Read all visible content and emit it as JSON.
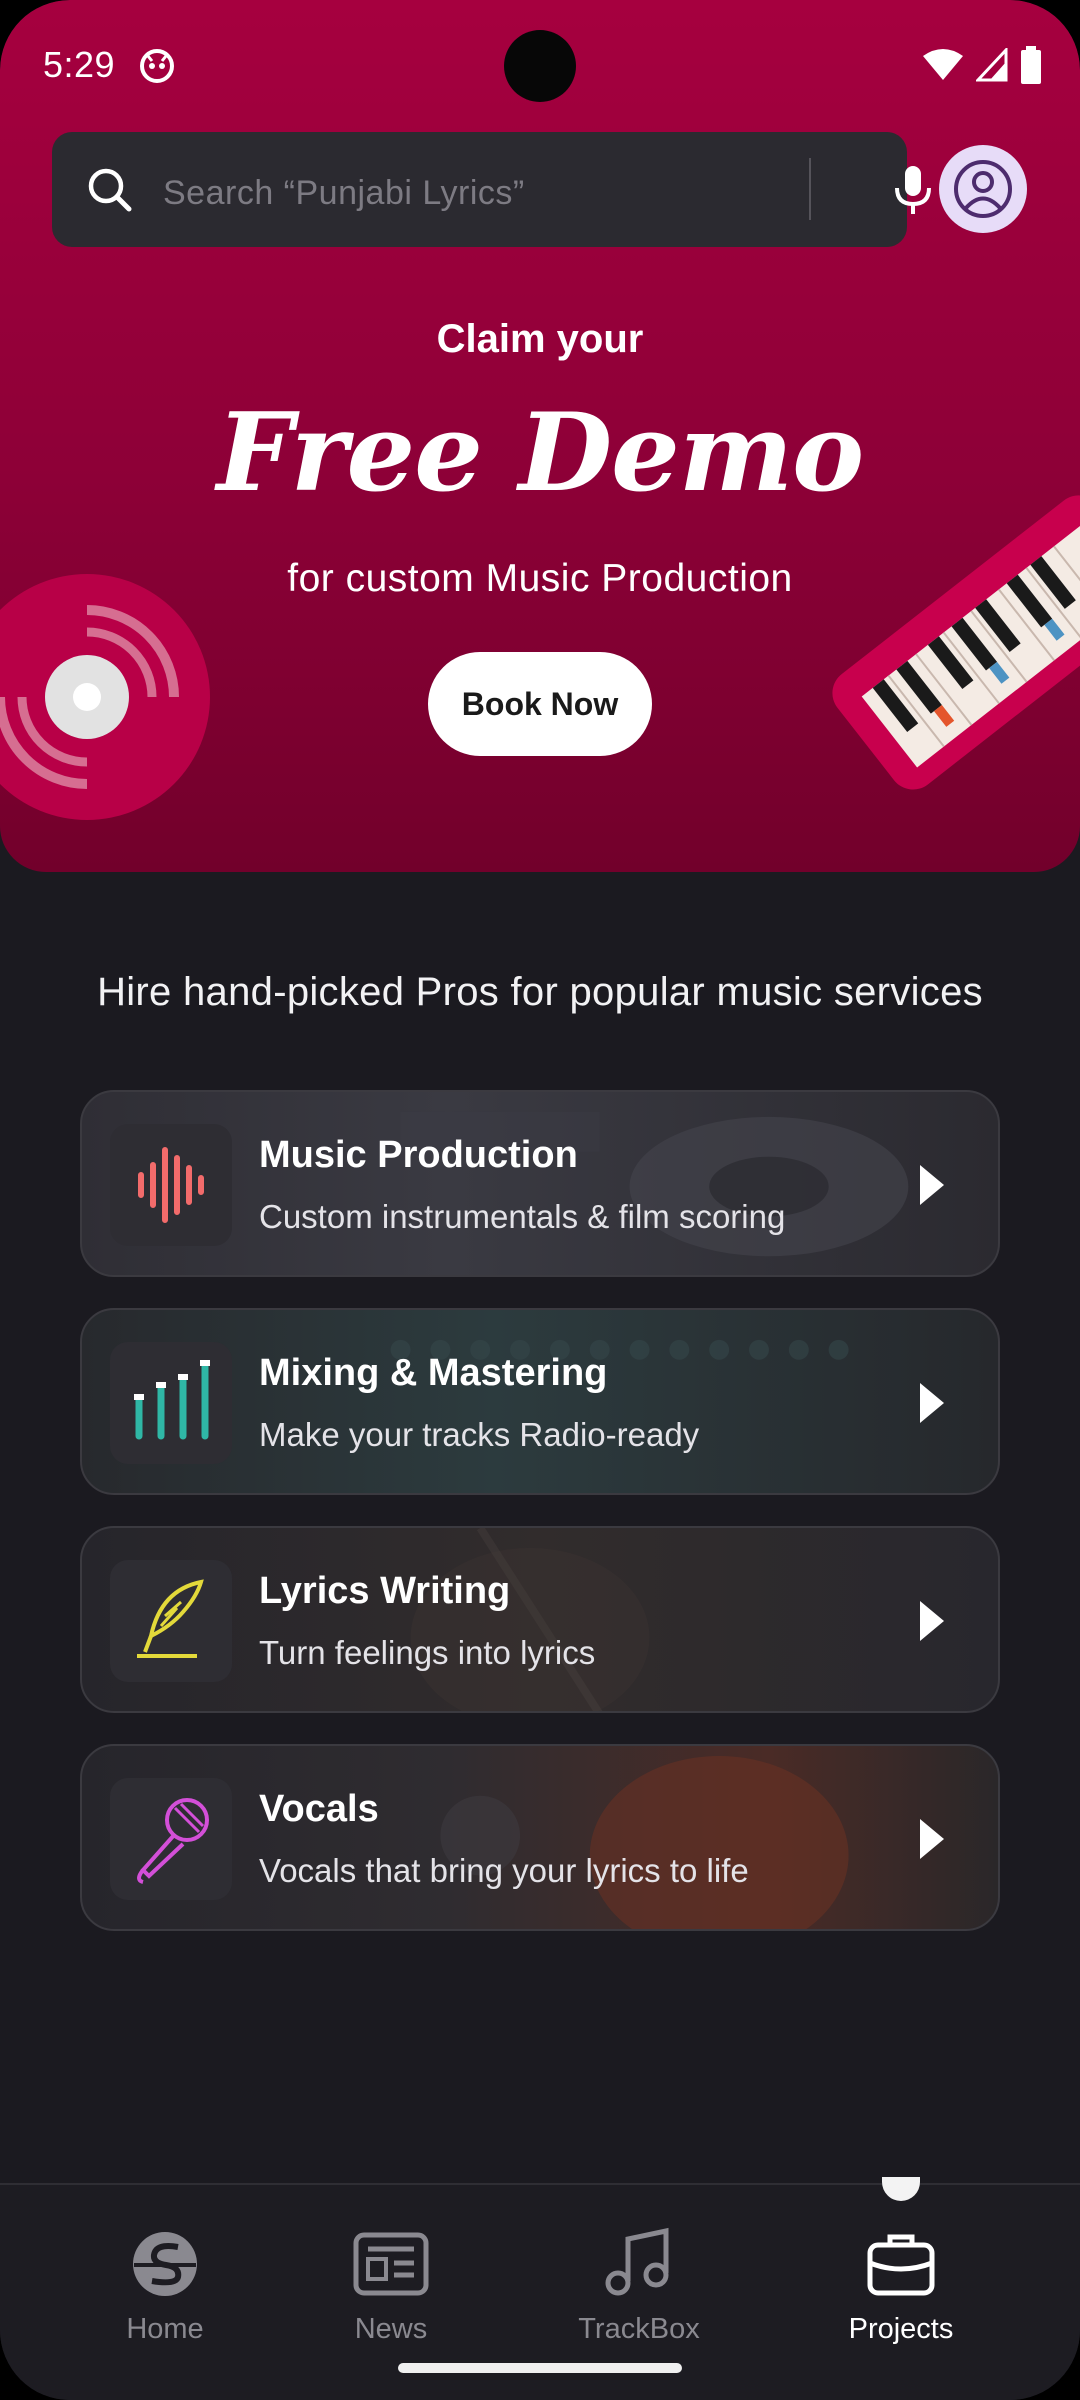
{
  "status_bar": {
    "time": "5:29"
  },
  "search": {
    "placeholder": "Search “Punjabi Lyrics”"
  },
  "hero": {
    "claim": "Claim your",
    "headline": "Free Demo",
    "subline": "for custom Music Production",
    "button_label": "Book Now",
    "background_color": "#a6003f"
  },
  "section_heading": "Hire hand-picked Pros for popular music services",
  "services": [
    {
      "title": "Music Production",
      "description": "Custom instrumentals & film scoring",
      "icon": "waveform-icon",
      "accent": "#f26b6b"
    },
    {
      "title": "Mixing & Mastering",
      "description": "Make your tracks Radio-ready",
      "icon": "faders-icon",
      "accent": "#2fb7a6"
    },
    {
      "title": "Lyrics Writing",
      "description": "Turn feelings into lyrics",
      "icon": "quill-icon",
      "accent": "#e3d93a"
    },
    {
      "title": "Vocals",
      "description": "Vocals that bring your lyrics to life",
      "icon": "microphone-icon",
      "accent": "#d34fd8"
    }
  ],
  "nav": {
    "items": [
      {
        "label": "Home",
        "icon": "home-logo-icon",
        "active": false
      },
      {
        "label": "News",
        "icon": "news-icon",
        "active": false
      },
      {
        "label": "TrackBox",
        "icon": "music-note-icon",
        "active": false
      },
      {
        "label": "Projects",
        "icon": "briefcase-icon",
        "active": true
      }
    ]
  }
}
